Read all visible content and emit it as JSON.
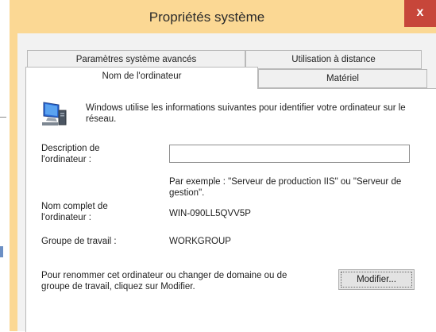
{
  "window": {
    "title": "Propriétés système",
    "close_glyph": "x"
  },
  "tabs": [
    {
      "label": "Paramètres système avancés",
      "active": false
    },
    {
      "label": "Utilisation à distance",
      "active": false
    },
    {
      "label": "Nom de l'ordinateur",
      "active": true
    },
    {
      "label": "Matériel",
      "active": false
    }
  ],
  "panel": {
    "icon": "computer-icon",
    "intro": "Windows utilise les informations suivantes pour identifier votre ordinateur sur le réseau.",
    "description_label": "Description de l'ordinateur :",
    "description_value": "",
    "example_text": "Par exemple : \"Serveur de production IIS\" ou \"Serveur de gestion\".",
    "fullname_label": "Nom complet de l'ordinateur :",
    "fullname_value": "WIN-090LL5QVV5P",
    "workgroup_label": "Groupe de travail :",
    "workgroup_value": "WORKGROUP",
    "rename_text": "Pour renommer cet ordinateur ou changer de domaine ou de groupe de travail, cliquez sur Modifier.",
    "modify_button": "Modifier..."
  },
  "colors": {
    "title_bar": "#fbd894",
    "close_button": "#c7463a",
    "panel_background": "#ffffff"
  }
}
